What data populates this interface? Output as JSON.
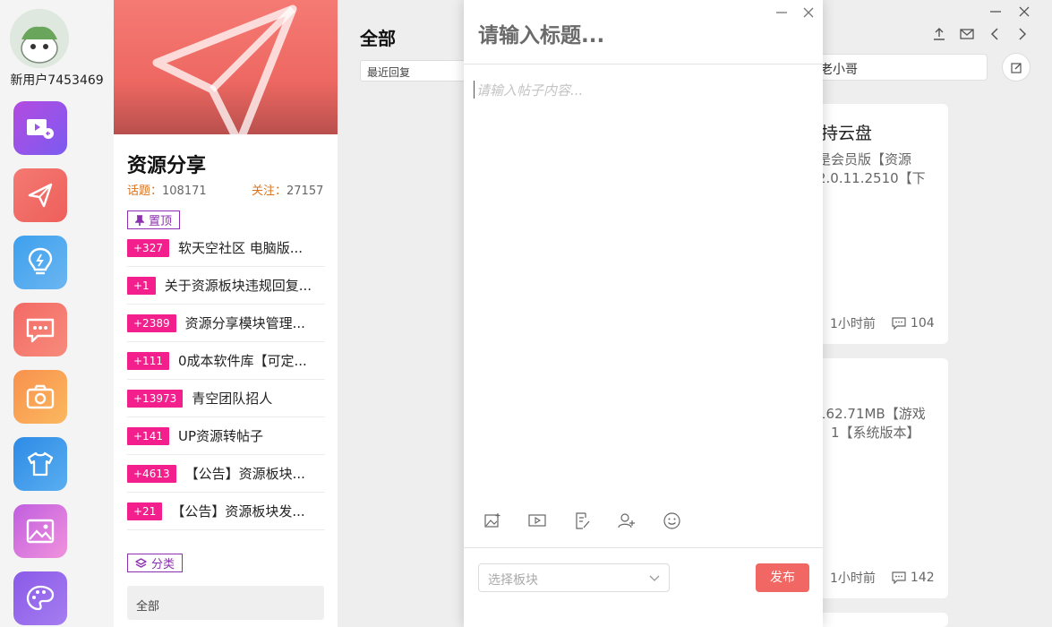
{
  "user": {
    "name": "新用户7453469",
    "avatar_text": "灰鹿像"
  },
  "board": {
    "name": "资源分享",
    "topics_label": "话题：",
    "topics_value": "108171",
    "follow_label": "关注：",
    "follow_value": "27157",
    "pinned_label": "置顶",
    "pinned": [
      {
        "badge": "+327",
        "title": "软天空社区 电脑版..."
      },
      {
        "badge": "+1",
        "title": "关于资源板块违规回复..."
      },
      {
        "badge": "+2389",
        "title": "资源分享模块管理..."
      },
      {
        "badge": "+111",
        "title": "0成本软件库【可定..."
      },
      {
        "badge": "+13973",
        "title": "青空团队招人"
      },
      {
        "badge": "+141",
        "title": "UP资源转帖子"
      },
      {
        "badge": "+4613",
        "title": "【公告】资源板块..."
      },
      {
        "badge": "+21",
        "title": "【公告】资源板块发..."
      }
    ],
    "category_label": "分类",
    "category_all": "全部"
  },
  "main": {
    "title": "全部",
    "sort": "最近回复",
    "search_value": "老小哥",
    "cards": [
      {
        "title": "持云盘",
        "lines": [
          "是会员版【资源",
          "2.0.11.2510【下"
        ],
        "time": "1小时前",
        "comments": "104"
      },
      {
        "title": "",
        "lines": [
          "162.71MB【游戏",
          "】1【系统版本】"
        ],
        "time": "1小时前",
        "comments": "142"
      }
    ]
  },
  "dialog": {
    "title_placeholder": "请输入标题...",
    "body_placeholder": "请输入帖子内容...",
    "board_select_placeholder": "选择板块",
    "publish_label": "发布"
  },
  "colors": {
    "accent": "#f06763",
    "pin_badge": "#f21f8c",
    "purple_tag": "#8c2fb0",
    "stat_label": "#d9731f"
  },
  "rail_icons": [
    "video-icon",
    "paper-plane-icon",
    "lightbulb-icon",
    "chat-icon",
    "camera-icon",
    "tshirt-icon",
    "image-icon",
    "palette-icon"
  ]
}
